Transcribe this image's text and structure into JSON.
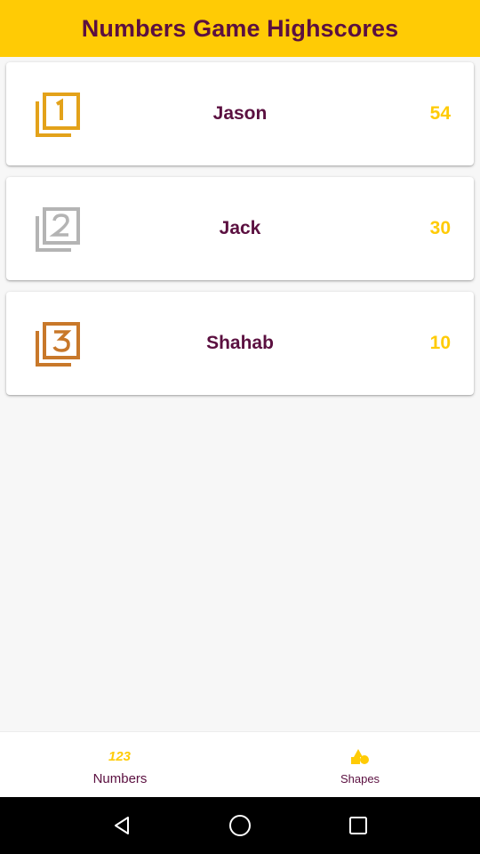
{
  "header": {
    "title": "Numbers Game Highscores"
  },
  "colors": {
    "primary": "#ffcb05",
    "title_text": "#5b1040",
    "rank1": "#e3a21a",
    "rank2": "#b4b4b4",
    "rank3": "#c8782a"
  },
  "scores": [
    {
      "rank": 1,
      "rank_icon": "rank-1-icon",
      "name": "Jason",
      "score": "54"
    },
    {
      "rank": 2,
      "rank_icon": "rank-2-icon",
      "name": "Jack",
      "score": "30"
    },
    {
      "rank": 3,
      "rank_icon": "rank-3-icon",
      "name": "Shahab",
      "score": "10"
    }
  ],
  "bottom_nav": [
    {
      "label": "Numbers",
      "icon": "numbers-123-icon",
      "active": true
    },
    {
      "label": "Shapes",
      "icon": "shapes-icon",
      "active": false
    }
  ],
  "system_nav": {
    "back": "back-icon",
    "home": "home-icon",
    "recents": "recents-icon"
  }
}
